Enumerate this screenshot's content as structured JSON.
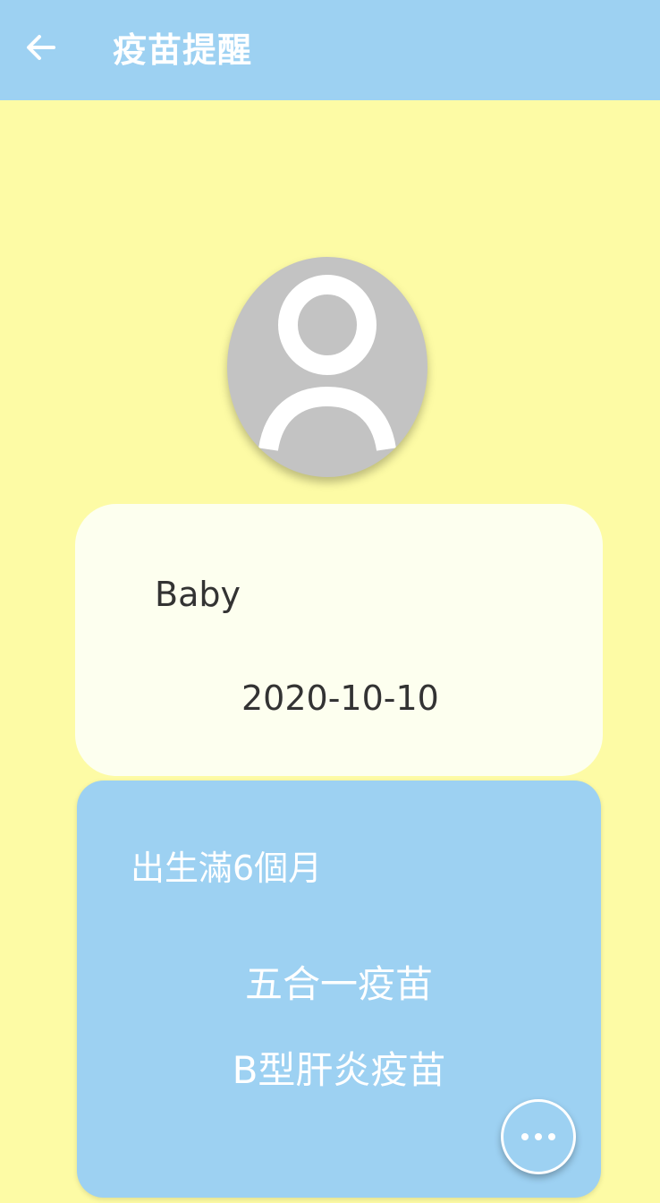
{
  "app_bar": {
    "title": "疫苗提醒",
    "back_icon": "arrow-left-icon",
    "background": "#9dd1f2"
  },
  "profile": {
    "avatar_icon": "person-placeholder-icon",
    "name": "Baby",
    "birthday": "2020-10-10"
  },
  "vaccine_reminder": {
    "age_label": "出生滿6個月",
    "vaccines": [
      "五合一疫苗",
      "B型肝炎疫苗"
    ],
    "more_icon": "more-horizontal-icon"
  },
  "colors": {
    "page_background": "#fdfba5",
    "card_background": "#fdffef",
    "accent_blue": "#9dd1f2"
  }
}
